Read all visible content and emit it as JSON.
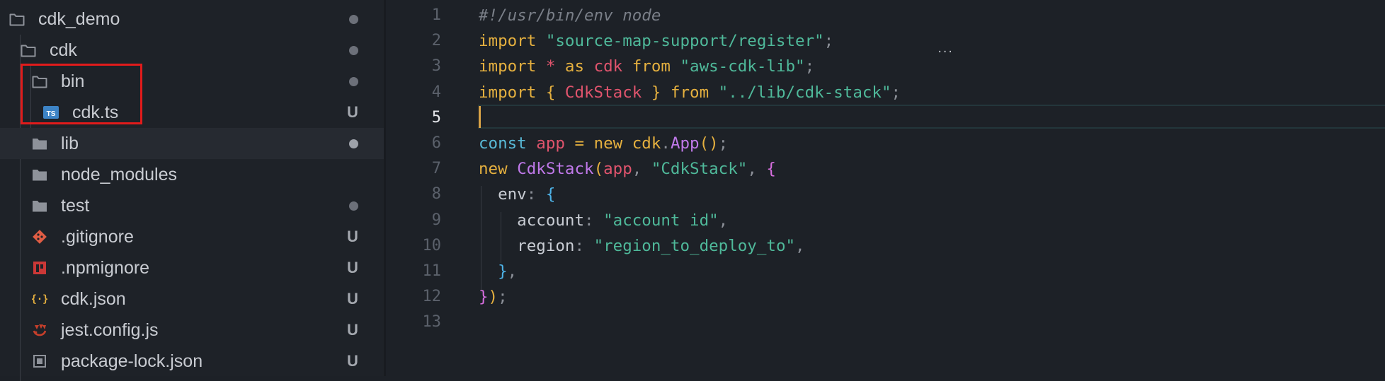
{
  "explorer": {
    "items": [
      {
        "label": "cdk_demo",
        "icon": "folder-outline-icon",
        "status": "dot"
      },
      {
        "label": "cdk",
        "icon": "folder-outline-icon",
        "status": "dot"
      },
      {
        "label": "bin",
        "icon": "folder-outline-icon",
        "status": "dot"
      },
      {
        "label": "cdk.ts",
        "icon": "typescript-file-icon",
        "icon_text": "TS",
        "status": "U"
      },
      {
        "label": "lib",
        "icon": "folder-filled-icon",
        "status": "dot"
      },
      {
        "label": "node_modules",
        "icon": "folder-filled-icon",
        "status": ""
      },
      {
        "label": "test",
        "icon": "folder-filled-icon",
        "status": "dot"
      },
      {
        "label": ".gitignore",
        "icon": "git-icon",
        "status": "U"
      },
      {
        "label": ".npmignore",
        "icon": "npm-icon",
        "status": "U"
      },
      {
        "label": "cdk.json",
        "icon": "json-icon",
        "icon_text": "{·}",
        "status": "U"
      },
      {
        "label": "jest.config.js",
        "icon": "jest-icon",
        "status": "U"
      },
      {
        "label": "package-lock.json",
        "icon": "package-lock-icon",
        "status": "U"
      }
    ]
  },
  "editor": {
    "active_line": 5,
    "lines": [
      {
        "n": "1",
        "tokens": [
          {
            "t": "#!/usr/bin/env node",
            "c": "comment"
          }
        ]
      },
      {
        "n": "2",
        "tokens": [
          {
            "t": "import ",
            "c": "kw"
          },
          {
            "t": "\"source-map-support/register\"",
            "c": "str"
          },
          {
            "t": ";",
            "c": "punct"
          }
        ]
      },
      {
        "n": "3",
        "tokens": [
          {
            "t": "import ",
            "c": "kw"
          },
          {
            "t": "* ",
            "c": "var"
          },
          {
            "t": "as ",
            "c": "kw"
          },
          {
            "t": "cdk ",
            "c": "var"
          },
          {
            "t": "from ",
            "c": "kw"
          },
          {
            "t": "\"aws-cdk-lib\"",
            "c": "str"
          },
          {
            "t": ";",
            "c": "punct"
          }
        ]
      },
      {
        "n": "4",
        "tokens": [
          {
            "t": "import ",
            "c": "kw"
          },
          {
            "t": "{ ",
            "c": "brace1"
          },
          {
            "t": "CdkStack ",
            "c": "class"
          },
          {
            "t": "} ",
            "c": "brace1"
          },
          {
            "t": "from ",
            "c": "kw"
          },
          {
            "t": "\"../lib/cdk-stack\"",
            "c": "str"
          },
          {
            "t": ";",
            "c": "punct"
          }
        ]
      },
      {
        "n": "5",
        "tokens": []
      },
      {
        "n": "6",
        "tokens": [
          {
            "t": "const ",
            "c": "blue"
          },
          {
            "t": "app ",
            "c": "var"
          },
          {
            "t": "= ",
            "c": "kw"
          },
          {
            "t": "new ",
            "c": "kw"
          },
          {
            "t": "cdk",
            "c": "kw"
          },
          {
            "t": ".",
            "c": "punct"
          },
          {
            "t": "App",
            "c": "fn"
          },
          {
            "t": "()",
            "c": "brace1"
          },
          {
            "t": ";",
            "c": "punct"
          }
        ]
      },
      {
        "n": "7",
        "tokens": [
          {
            "t": "new ",
            "c": "kw"
          },
          {
            "t": "CdkStack",
            "c": "fn"
          },
          {
            "t": "(",
            "c": "brace1"
          },
          {
            "t": "app",
            "c": "var"
          },
          {
            "t": ", ",
            "c": "punct"
          },
          {
            "t": "\"CdkStack\"",
            "c": "str"
          },
          {
            "t": ", ",
            "c": "punct"
          },
          {
            "t": "{",
            "c": "brace2"
          }
        ]
      },
      {
        "n": "8",
        "tokens": [
          {
            "t": "  env",
            "c": "prop"
          },
          {
            "t": ": ",
            "c": "punct"
          },
          {
            "t": "{",
            "c": "brace3"
          }
        ]
      },
      {
        "n": "9",
        "tokens": [
          {
            "t": "    account",
            "c": "prop"
          },
          {
            "t": ": ",
            "c": "punct"
          },
          {
            "t": "\"account id\"",
            "c": "str"
          },
          {
            "t": ",",
            "c": "punct"
          }
        ]
      },
      {
        "n": "10",
        "tokens": [
          {
            "t": "    region",
            "c": "prop"
          },
          {
            "t": ": ",
            "c": "punct"
          },
          {
            "t": "\"region_to_deploy_to\"",
            "c": "str"
          },
          {
            "t": ",",
            "c": "punct"
          }
        ]
      },
      {
        "n": "11",
        "tokens": [
          {
            "t": "  ",
            "c": "text"
          },
          {
            "t": "}",
            "c": "brace3"
          },
          {
            "t": ",",
            "c": "punct"
          }
        ]
      },
      {
        "n": "12",
        "tokens": [
          {
            "t": "}",
            "c": "brace2"
          },
          {
            "t": ")",
            "c": "brace1"
          },
          {
            "t": ";",
            "c": "punct"
          }
        ]
      },
      {
        "n": "13",
        "tokens": []
      }
    ]
  },
  "colors": {
    "highlight_box": "#e11b1b",
    "cursor": "#d9a347",
    "folder": "#8e929a",
    "git": "#e05d44",
    "npm": "#cb3837",
    "json": "#e5b03f",
    "typescript": "#3d84c6"
  }
}
